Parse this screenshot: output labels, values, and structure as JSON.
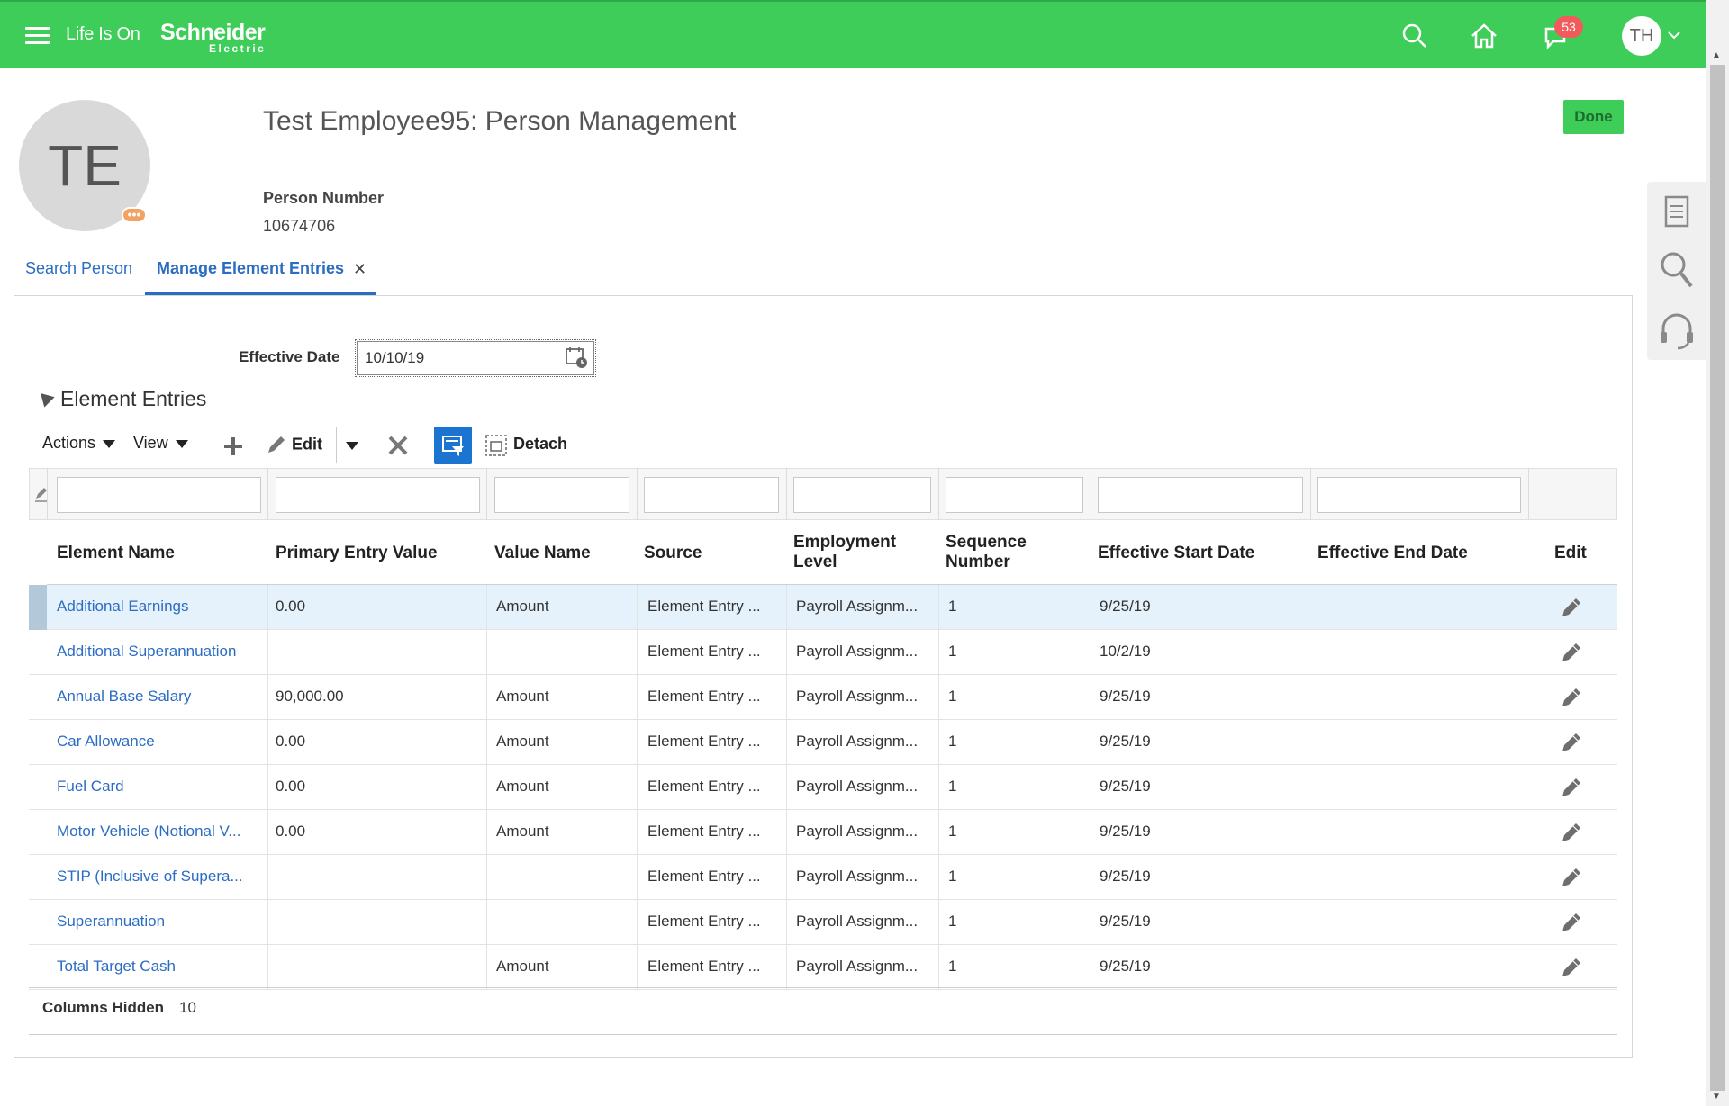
{
  "topbar": {
    "brand_tagline": "Life Is On",
    "brand_name": "Schneider",
    "brand_sub": "Electric",
    "notification_count": "53",
    "user_initials": "TH",
    "accent_color": "#3dcd58"
  },
  "person": {
    "initials": "TE",
    "title": "Test Employee95: Person Management",
    "person_number_label": "Person Number",
    "person_number": "10674706",
    "done_label": "Done"
  },
  "tabs": [
    {
      "label": "Search Person",
      "active": false
    },
    {
      "label": "Manage Element Entries",
      "active": true
    }
  ],
  "form": {
    "effective_date_label": "Effective Date",
    "effective_date_value": "10/10/19"
  },
  "section": {
    "title": "Element Entries"
  },
  "toolbar": {
    "actions_label": "Actions",
    "view_label": "View",
    "edit_label": "Edit",
    "detach_label": "Detach"
  },
  "table": {
    "headers": {
      "element_name": "Element Name",
      "primary_entry_value": "Primary Entry Value",
      "value_name": "Value Name",
      "source": "Source",
      "employment_level_1": "Employment",
      "employment_level_2": "Level",
      "sequence_number_1": "Sequence",
      "sequence_number_2": "Number",
      "effective_start_date": "Effective Start Date",
      "effective_end_date": "Effective End Date",
      "edit": "Edit"
    },
    "rows": [
      {
        "element_name": "Additional Earnings",
        "primary_entry_value": "0.00",
        "value_name": "Amount",
        "source": "Element Entry ...",
        "employment_level": "Payroll Assignm...",
        "sequence_number": "1",
        "effective_start_date": "9/25/19",
        "effective_end_date": "",
        "selected": true
      },
      {
        "element_name": "Additional Superannuation",
        "primary_entry_value": "",
        "value_name": "",
        "source": "Element Entry ...",
        "employment_level": "Payroll Assignm...",
        "sequence_number": "1",
        "effective_start_date": "10/2/19",
        "effective_end_date": "",
        "selected": false
      },
      {
        "element_name": "Annual Base Salary",
        "primary_entry_value": "90,000.00",
        "value_name": "Amount",
        "source": "Element Entry ...",
        "employment_level": "Payroll Assignm...",
        "sequence_number": "1",
        "effective_start_date": "9/25/19",
        "effective_end_date": "",
        "selected": false
      },
      {
        "element_name": "Car Allowance",
        "primary_entry_value": "0.00",
        "value_name": "Amount",
        "source": "Element Entry ...",
        "employment_level": "Payroll Assignm...",
        "sequence_number": "1",
        "effective_start_date": "9/25/19",
        "effective_end_date": "",
        "selected": false
      },
      {
        "element_name": "Fuel Card",
        "primary_entry_value": "0.00",
        "value_name": "Amount",
        "source": "Element Entry ...",
        "employment_level": "Payroll Assignm...",
        "sequence_number": "1",
        "effective_start_date": "9/25/19",
        "effective_end_date": "",
        "selected": false
      },
      {
        "element_name": "Motor Vehicle (Notional V...",
        "primary_entry_value": "0.00",
        "value_name": "Amount",
        "source": "Element Entry ...",
        "employment_level": "Payroll Assignm...",
        "sequence_number": "1",
        "effective_start_date": "9/25/19",
        "effective_end_date": "",
        "selected": false
      },
      {
        "element_name": "STIP (Inclusive of Supera...",
        "primary_entry_value": "",
        "value_name": "",
        "source": "Element Entry ...",
        "employment_level": "Payroll Assignm...",
        "sequence_number": "1",
        "effective_start_date": "9/25/19",
        "effective_end_date": "",
        "selected": false
      },
      {
        "element_name": "Superannuation",
        "primary_entry_value": "",
        "value_name": "",
        "source": "Element Entry ...",
        "employment_level": "Payroll Assignm...",
        "sequence_number": "1",
        "effective_start_date": "9/25/19",
        "effective_end_date": "",
        "selected": false
      },
      {
        "element_name": "Total Target Cash",
        "primary_entry_value": "",
        "value_name": "Amount",
        "source": "Element Entry ...",
        "employment_level": "Payroll Assignm...",
        "sequence_number": "1",
        "effective_start_date": "9/25/19",
        "effective_end_date": "",
        "selected": false
      }
    ],
    "columns_hidden_label": "Columns Hidden",
    "columns_hidden_value": "10"
  }
}
